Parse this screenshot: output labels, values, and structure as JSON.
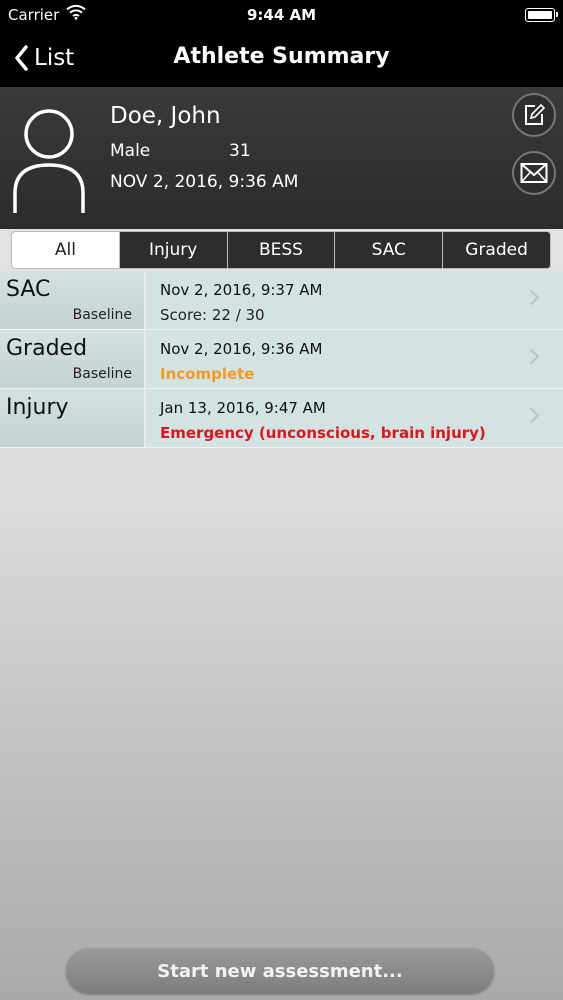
{
  "status_bar": {
    "carrier": "Carrier",
    "time": "9:44 AM",
    "wifi_icon": "wifi-icon",
    "battery_icon": "battery-icon"
  },
  "nav": {
    "back_label": "List",
    "title": "Athlete Summary"
  },
  "athlete": {
    "name": "Doe, John",
    "gender": "Male",
    "age": "31",
    "date": "NOV 2, 2016, 9:36 AM",
    "avatar_icon": "person-icon"
  },
  "actions": {
    "edit_icon": "edit-icon",
    "mail_icon": "mail-icon"
  },
  "tabs": [
    {
      "label": "All",
      "active": true
    },
    {
      "label": "Injury",
      "active": false
    },
    {
      "label": "BESS",
      "active": false
    },
    {
      "label": "SAC",
      "active": false
    },
    {
      "label": "Graded",
      "active": false
    }
  ],
  "assessments": [
    {
      "type": "SAC",
      "sub": "Baseline",
      "date": "Nov 2, 2016, 9:37 AM",
      "detail": "Score: 22 / 30",
      "status": "normal"
    },
    {
      "type": "Graded",
      "sub": "Baseline",
      "date": "Nov 2, 2016, 9:36 AM",
      "detail": "Incomplete",
      "status": "warn"
    },
    {
      "type": "Injury",
      "sub": "",
      "date": "Jan 13, 2016, 9:47 AM",
      "detail": "Emergency (unconscious, brain injury)",
      "status": "danger"
    }
  ],
  "footer": {
    "start_label": "Start new assessment..."
  },
  "colors": {
    "warning": "#f39a1c",
    "danger": "#e0141b",
    "row_background": "#d3e2e2"
  }
}
